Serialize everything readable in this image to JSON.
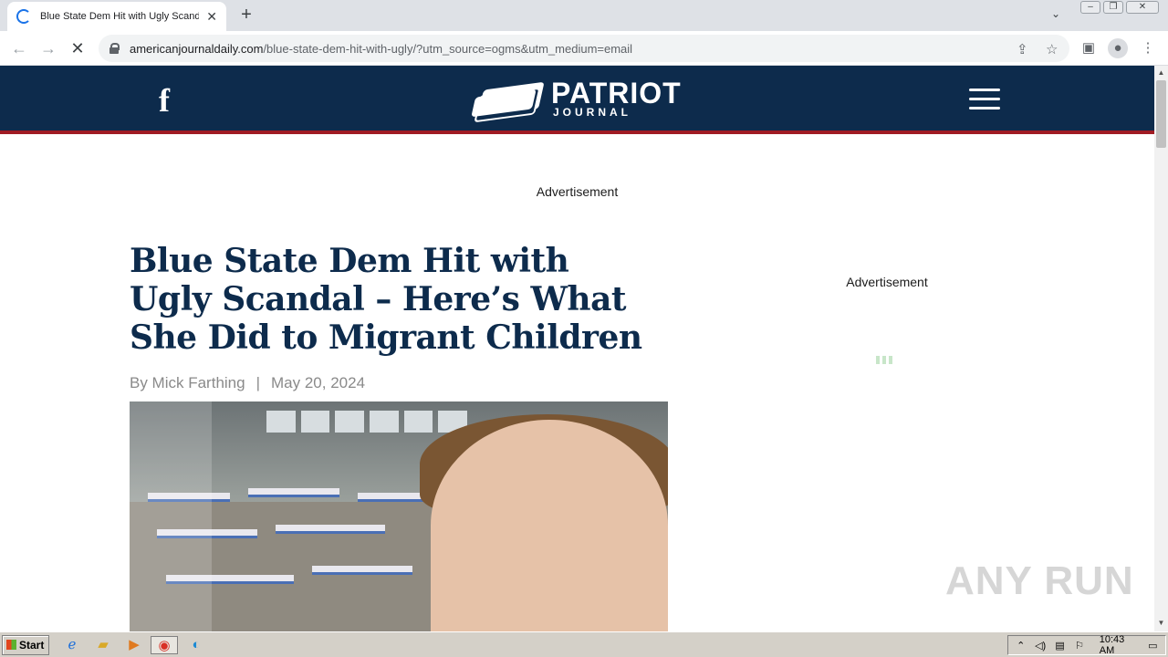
{
  "browser": {
    "tab_title": "Blue State Dem Hit with Ugly Scandal – Here's What She Did to Migrant Children",
    "new_tab_symbol": "+",
    "url_host": "americanjournaldaily.com",
    "url_path": "/blue-state-dem-hit-with-ugly/?utm_source=ogms&utm_medium=email"
  },
  "site": {
    "social_icon": "f",
    "logo_main": "PATRIOT",
    "logo_sub": "JOURNAL",
    "brand_color": "#0d2b4c",
    "accent_color": "#a01c24"
  },
  "article": {
    "ad_label_top": "Advertisement",
    "ad_label_side": "Advertisement",
    "headline": "Blue State Dem Hit with Ugly Scandal – Here’s What She Did to Migrant Children",
    "byline_author": "By Mick Farthing",
    "byline_separator": "|",
    "byline_date": "May 20, 2024"
  },
  "watermark": "ANY RUN",
  "taskbar": {
    "start_label": "Start",
    "clock": "10:43 AM"
  }
}
